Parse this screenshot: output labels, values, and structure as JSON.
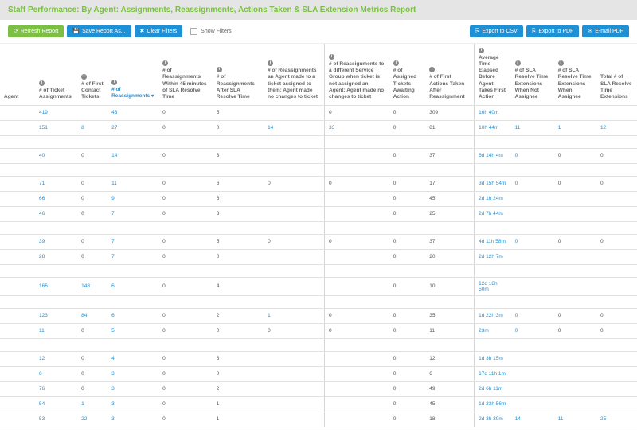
{
  "header": {
    "title": "Staff Performance: By Agent: Assignments, Reassignments, Actions Taken & SLA Extension Metrics Report"
  },
  "toolbar": {
    "refresh": "Refresh Report",
    "saveAs": "Save Report As...",
    "clearFilters": "Clear Filters",
    "showFilters": "Show Filters",
    "exportCsv": "Export to CSV",
    "exportPdf": "Export to PDF",
    "emailPdf": "E-mail PDF"
  },
  "columns": [
    {
      "key": "agent",
      "label": "Agent"
    },
    {
      "key": "ticketAssign",
      "label": "# of Ticket Assignments",
      "info": true
    },
    {
      "key": "firstContact",
      "label": "# of First Contact Tickets",
      "info": true
    },
    {
      "key": "reassign",
      "label": "# of Reassignments",
      "info": true,
      "sorted": true
    },
    {
      "key": "within45",
      "label": "# of Reassignments Within 45 minutes of SLA Resolve Time",
      "info": true
    },
    {
      "key": "afterSla",
      "label": "# of Reassignments After SLA Resolve Time",
      "info": true
    },
    {
      "key": "agentNoChg",
      "label": "# of Reassignments an Agent made to a ticket assigned to them; Agent made no changes to ticket",
      "info": true
    },
    {
      "key": "diffGroup",
      "label": "# of Reassignments to a different Service Group when ticket is not assigned an Agent; Agent made no changes to ticket",
      "info": true
    },
    {
      "key": "awaiting",
      "label": "# of Assigned Tickets Awaiting Action",
      "info": true
    },
    {
      "key": "firstActions",
      "label": "# of First Actions Taken After Reassignment",
      "info": true
    },
    {
      "key": "avgTime",
      "label": "Average Time Elapsed Before Agent Takes First Action",
      "info": true
    },
    {
      "key": "extNotAssignee",
      "label": "# of SLA Resolve Time Extensions When Not Assignee",
      "info": true
    },
    {
      "key": "extAssignee",
      "label": "# of SLA Resolve Time Extensions When Assignee",
      "info": true
    },
    {
      "key": "totalExt",
      "label": "Total # of SLA Resolve Time Extensions"
    }
  ],
  "rows": [
    {
      "agent": "",
      "c": [
        "419",
        "",
        "43",
        "0",
        "5",
        "",
        "0",
        "0",
        "309",
        "16h 40m",
        "",
        "",
        ""
      ],
      "links": [
        0,
        2,
        9,
        10
      ]
    },
    {
      "agent": "",
      "c": [
        "151",
        "8",
        "27",
        "0",
        "0",
        "14",
        "33",
        "0",
        "81",
        "10h 44m",
        "11",
        "1",
        "12"
      ],
      "links": [
        0,
        1,
        2,
        5,
        6,
        9,
        10,
        11,
        12,
        13
      ]
    },
    {
      "spacer": true
    },
    {
      "agent": "",
      "c": [
        "40",
        "0",
        "14",
        "0",
        "3",
        "",
        "",
        "0",
        "37",
        "6d 14h 4m",
        "0",
        "0",
        "0"
      ],
      "links": [
        0,
        2,
        9,
        10
      ]
    },
    {
      "spacer": true
    },
    {
      "agent": "",
      "c": [
        "71",
        "0",
        "11",
        "0",
        "6",
        "0",
        "0",
        "0",
        "17",
        "3d 15h 54m",
        "0",
        "0",
        "0"
      ],
      "links": [
        0,
        2,
        9,
        10
      ]
    },
    {
      "agent": "",
      "c": [
        "66",
        "0",
        "9",
        "0",
        "6",
        "",
        "",
        "0",
        "45",
        "2d 1h 24m",
        "",
        "",
        ""
      ],
      "links": [
        0,
        2,
        9,
        10
      ]
    },
    {
      "agent": "",
      "c": [
        "46",
        "0",
        "7",
        "0",
        "3",
        "",
        "",
        "0",
        "25",
        "2d 7h 44m",
        "",
        "",
        ""
      ],
      "links": [
        0,
        2,
        9,
        10
      ]
    },
    {
      "spacer": true
    },
    {
      "agent": "",
      "c": [
        "39",
        "0",
        "7",
        "0",
        "5",
        "0",
        "0",
        "0",
        "37",
        "4d 11h 58m",
        "0",
        "0",
        "0"
      ],
      "links": [
        0,
        2,
        9,
        10
      ]
    },
    {
      "agent": "",
      "c": [
        "28",
        "0",
        "7",
        "0",
        "0",
        "",
        "",
        "0",
        "20",
        "2d 12h 7m",
        "",
        "",
        ""
      ],
      "links": [
        0,
        2,
        9,
        10
      ]
    },
    {
      "spacer": true
    },
    {
      "agent": "",
      "c": [
        "166",
        "148",
        "6",
        "0",
        "4",
        "",
        "",
        "0",
        "10",
        "12d 18h 50m",
        "",
        "",
        ""
      ],
      "links": [
        0,
        1,
        2,
        9,
        10
      ]
    },
    {
      "spacer": true
    },
    {
      "agent": "",
      "c": [
        "123",
        "84",
        "6",
        "0",
        "2",
        "1",
        "0",
        "0",
        "35",
        "1d 22h 3m",
        "0",
        "0",
        "0"
      ],
      "links": [
        0,
        1,
        2,
        5,
        9,
        10
      ]
    },
    {
      "agent": "",
      "c": [
        "11",
        "0",
        "5",
        "0",
        "0",
        "0",
        "0",
        "0",
        "11",
        "23m",
        "0",
        "0",
        "0"
      ],
      "links": [
        0,
        2,
        9,
        10
      ]
    },
    {
      "spacer": true
    },
    {
      "agent": "",
      "c": [
        "12",
        "0",
        "4",
        "0",
        "3",
        "",
        "",
        "0",
        "12",
        "1d 3h 15m",
        "",
        "",
        ""
      ],
      "links": [
        0,
        2,
        9,
        10
      ]
    },
    {
      "agent": "",
      "c": [
        "6",
        "0",
        "3",
        "0",
        "0",
        "",
        "",
        "0",
        "6",
        "17d 11h 1m",
        "",
        "",
        ""
      ],
      "links": [
        0,
        2,
        9,
        10
      ]
    },
    {
      "agent": "",
      "c": [
        "76",
        "0",
        "3",
        "0",
        "2",
        "",
        "",
        "0",
        "49",
        "2d 6h 11m",
        "",
        "",
        ""
      ],
      "links": [
        0,
        2,
        9,
        10
      ]
    },
    {
      "agent": "",
      "c": [
        "54",
        "1",
        "3",
        "0",
        "1",
        "",
        "",
        "0",
        "45",
        "1d 23h 56m",
        "",
        "",
        ""
      ],
      "links": [
        0,
        1,
        2,
        9,
        10
      ]
    },
    {
      "agent": "",
      "c": [
        "53",
        "22",
        "3",
        "0",
        "1",
        "",
        "",
        "0",
        "18",
        "2d 3h 39m",
        "14",
        "11",
        "25"
      ],
      "links": [
        0,
        1,
        2,
        9,
        10,
        11,
        12,
        13
      ]
    }
  ],
  "sepAfter": [
    7,
    10
  ]
}
